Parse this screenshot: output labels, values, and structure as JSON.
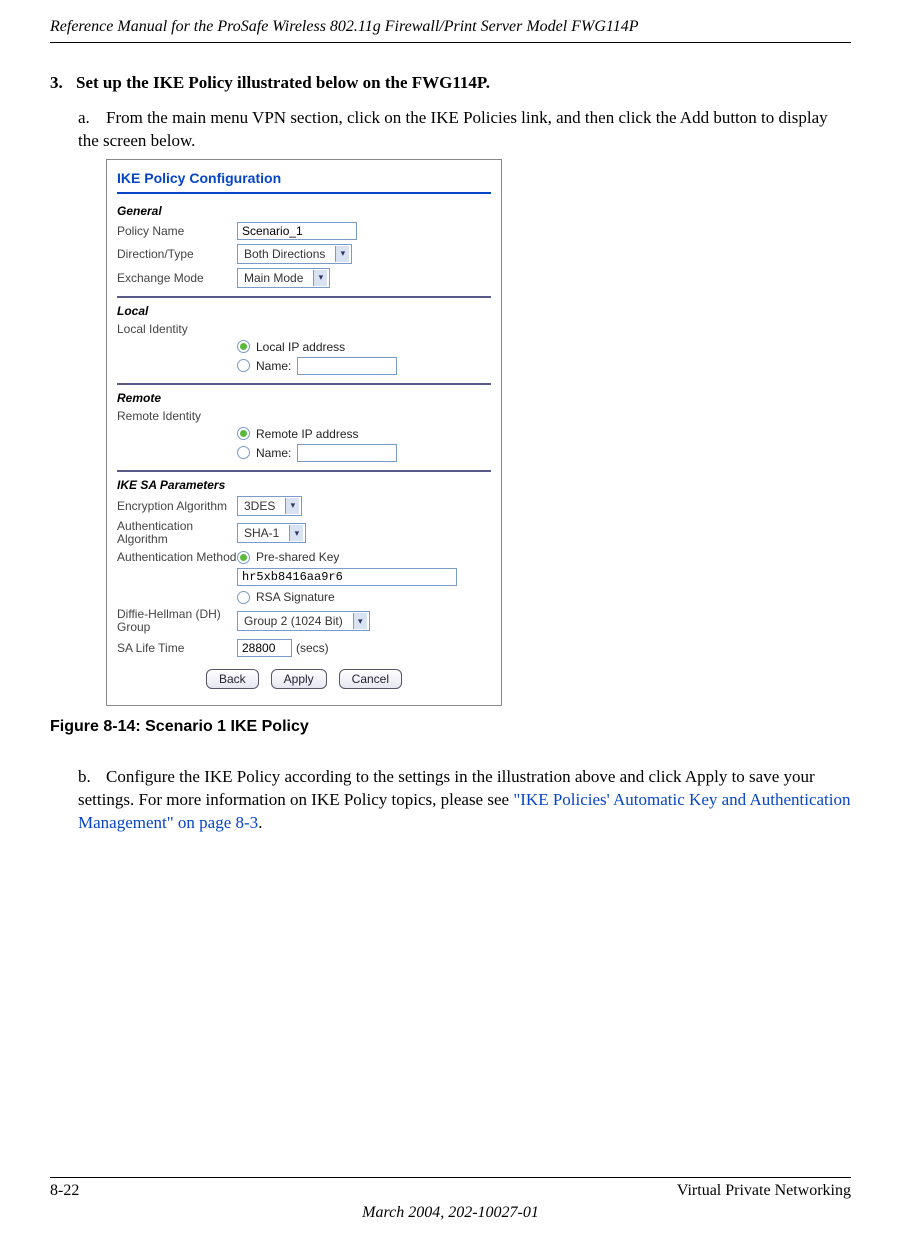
{
  "header": {
    "title": "Reference Manual for the ProSafe Wireless 802.11g  Firewall/Print Server Model FWG114P"
  },
  "step3": {
    "num": "3.",
    "text": "Set up the IKE Policy illustrated below on the FWG114P."
  },
  "substep_a": {
    "letter": "a.",
    "text": "From the main menu VPN section, click on the IKE Policies link, and then click the Add button to display the screen below."
  },
  "figure": {
    "title": "IKE Policy Configuration",
    "general": {
      "label": "General",
      "policy_name_label": "Policy Name",
      "policy_name_value": "Scenario_1",
      "direction_label": "Direction/Type",
      "direction_value": "Both Directions",
      "exchange_label": "Exchange Mode",
      "exchange_value": "Main Mode"
    },
    "local": {
      "label": "Local",
      "identity_label": "Local Identity",
      "opt1": "Local IP address",
      "opt2": "Name:"
    },
    "remote": {
      "label": "Remote",
      "identity_label": "Remote Identity",
      "opt1": "Remote IP address",
      "opt2": "Name:"
    },
    "sa": {
      "label": "IKE SA Parameters",
      "enc_label": "Encryption Algorithm",
      "enc_value": "3DES",
      "auth_alg_label": "Authentication Algorithm",
      "auth_alg_value": "SHA-1",
      "auth_method_label": "Authentication Method",
      "psk_opt": "Pre-shared Key",
      "psk_value": "hr5xb8416aa9r6",
      "rsa_opt": "RSA Signature",
      "dh_label": "Diffie-Hellman (DH) Group",
      "dh_value": "Group 2 (1024 Bit)",
      "life_label": "SA Life Time",
      "life_value": "28800",
      "life_suffix": "(secs)"
    },
    "buttons": {
      "back": "Back",
      "apply": "Apply",
      "cancel": "Cancel"
    }
  },
  "figure_caption": "Figure 8-14:  Scenario 1 IKE Policy",
  "substep_b": {
    "letter": "b.",
    "text1": "Configure the IKE Policy according to the settings in the illustration above and click Apply to save your settings. For more information on IKE Policy topics, please see ",
    "link": "\"IKE Policies' Automatic Key and Authentication Management\" on page 8-3",
    "text2": "."
  },
  "footer": {
    "page": "8-22",
    "section": "Virtual Private Networking",
    "date": "March 2004, 202-10027-01"
  }
}
